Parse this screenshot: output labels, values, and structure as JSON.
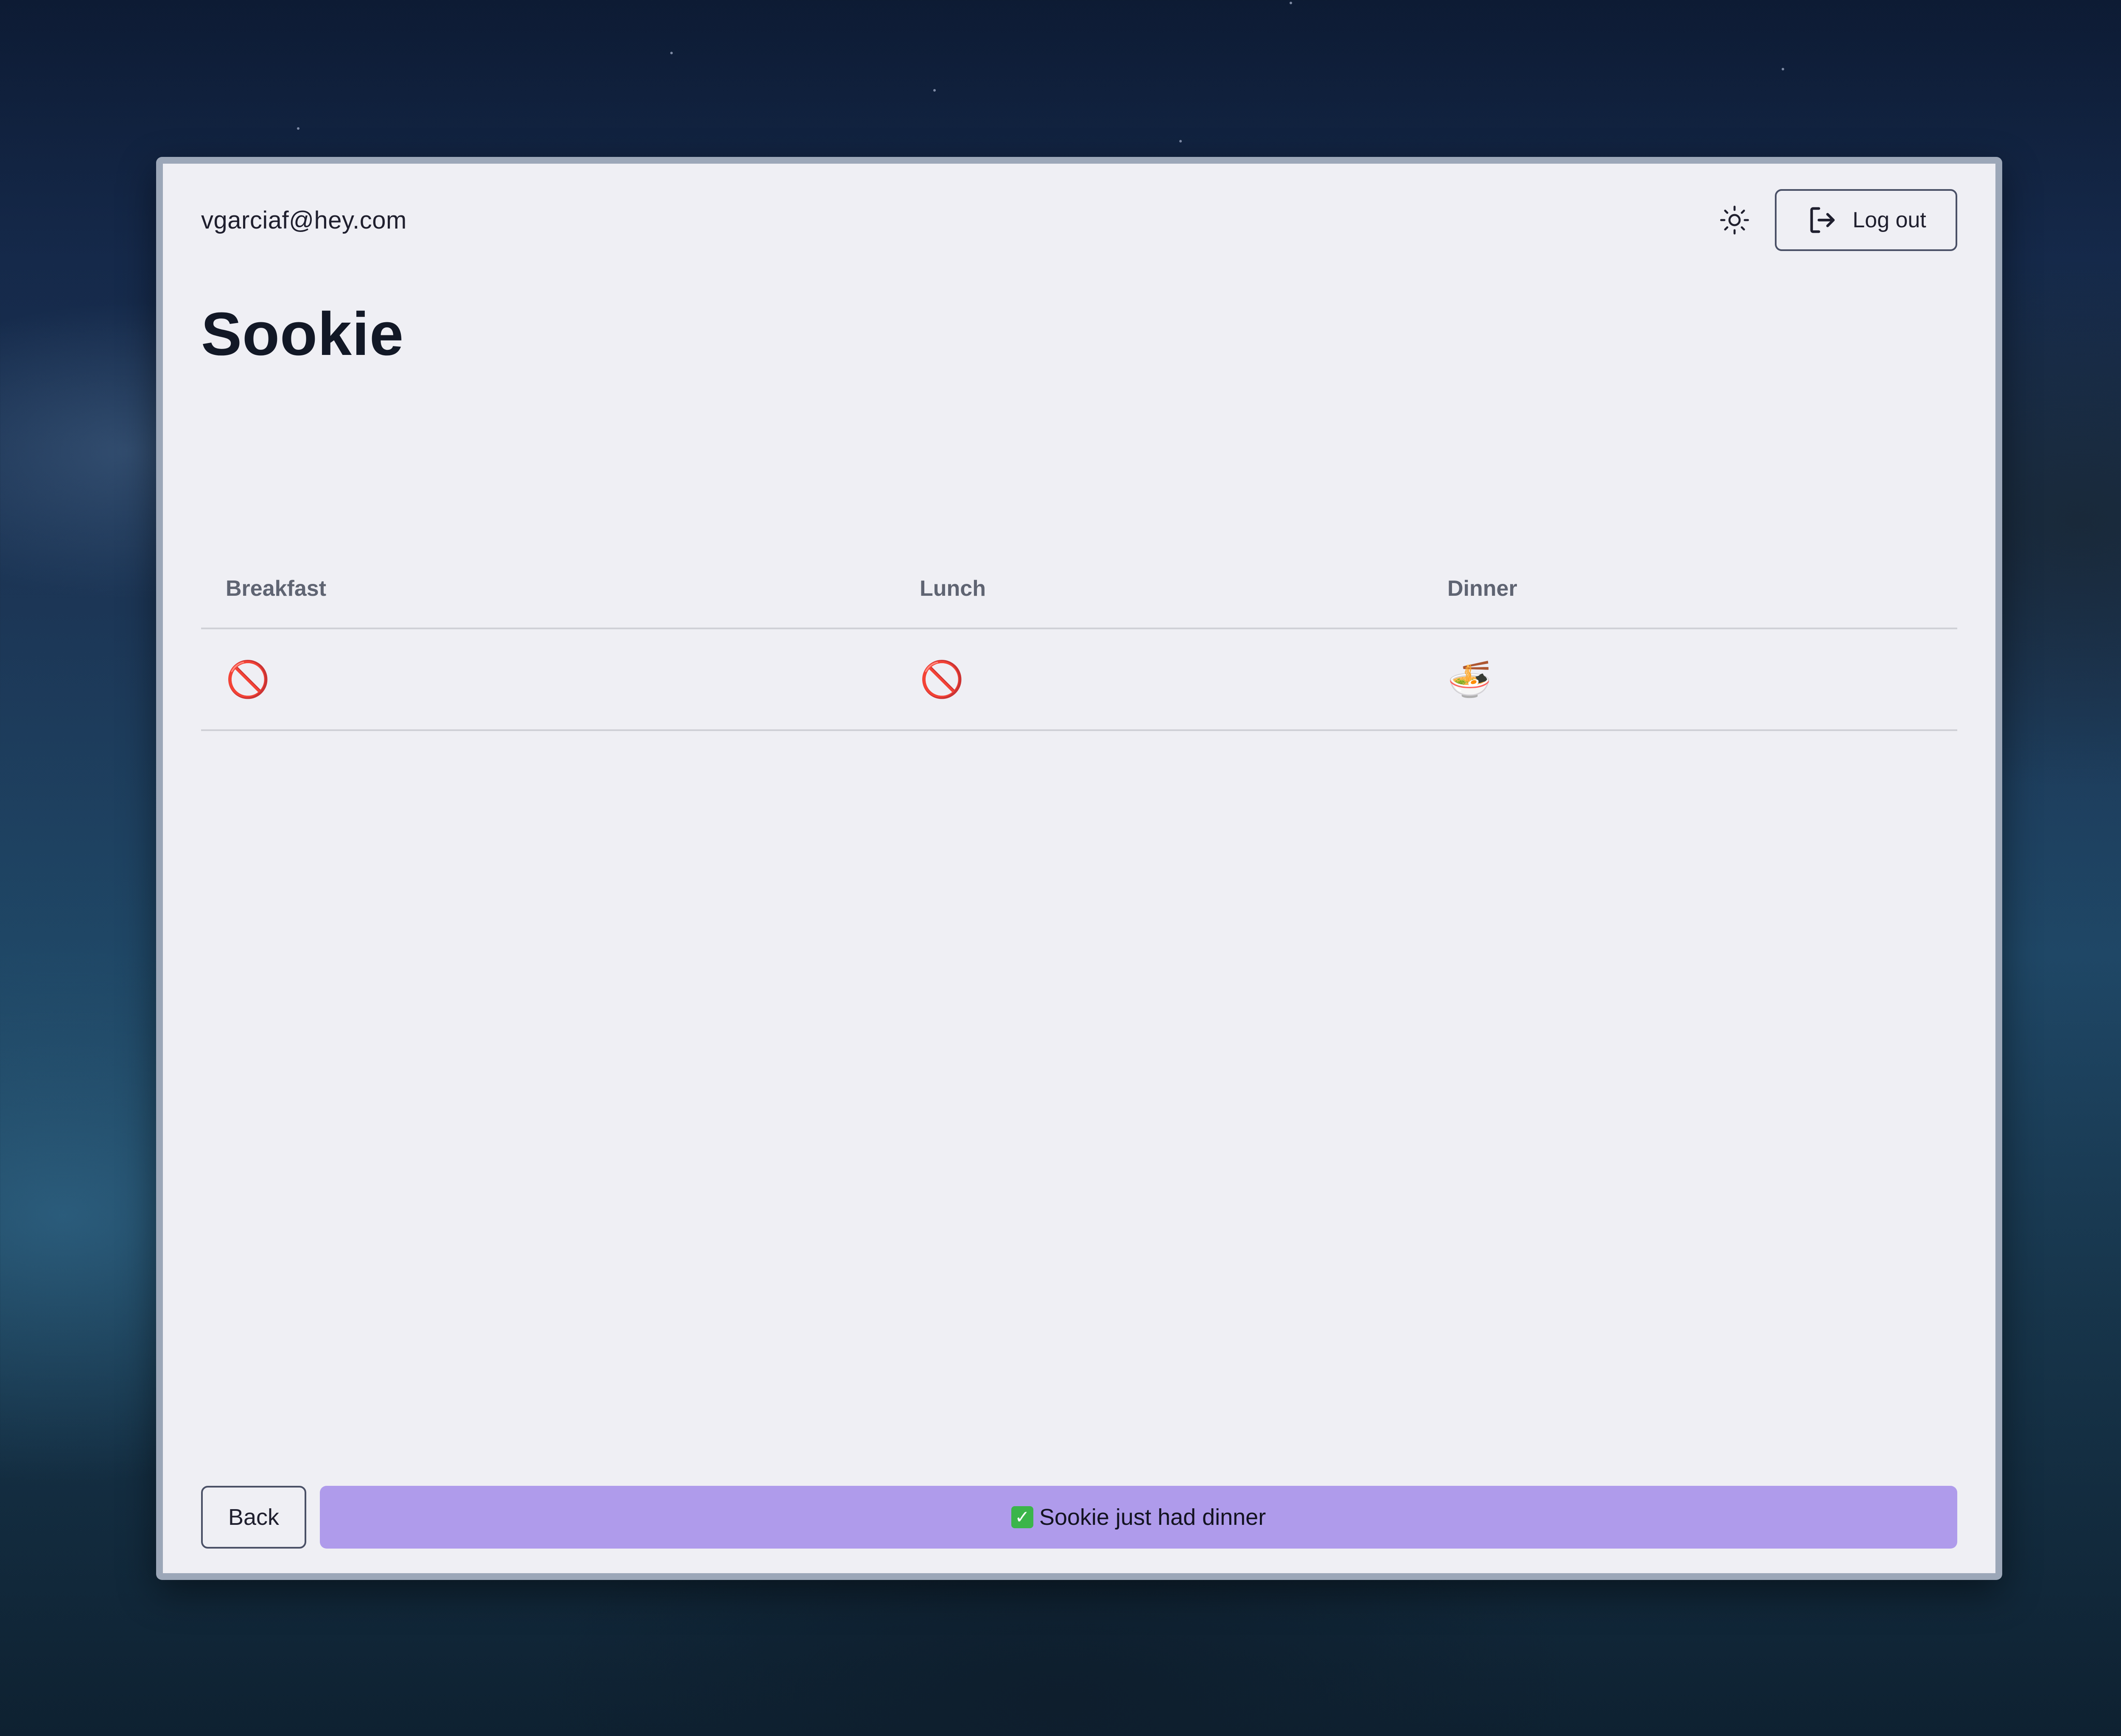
{
  "header": {
    "email": "vgarciaf@hey.com",
    "theme_icon": "sun-icon",
    "logout_icon": "logout-icon",
    "logout_label": "Log out"
  },
  "page": {
    "title": "Sookie"
  },
  "table": {
    "columns": [
      "Breakfast",
      "Lunch",
      "Dinner"
    ],
    "row": [
      {
        "meal": "Breakfast",
        "icon": "prohibited-icon",
        "glyph": "🚫"
      },
      {
        "meal": "Lunch",
        "icon": "prohibited-icon",
        "glyph": "🚫"
      },
      {
        "meal": "Dinner",
        "icon": "bowl-icon",
        "glyph": "🍜"
      }
    ]
  },
  "footer": {
    "back_label": "Back",
    "primary_label": "Sookie just had dinner",
    "primary_icon": "check-icon",
    "primary_icon_glyph": "✓",
    "primary_color": "#af9beb"
  }
}
